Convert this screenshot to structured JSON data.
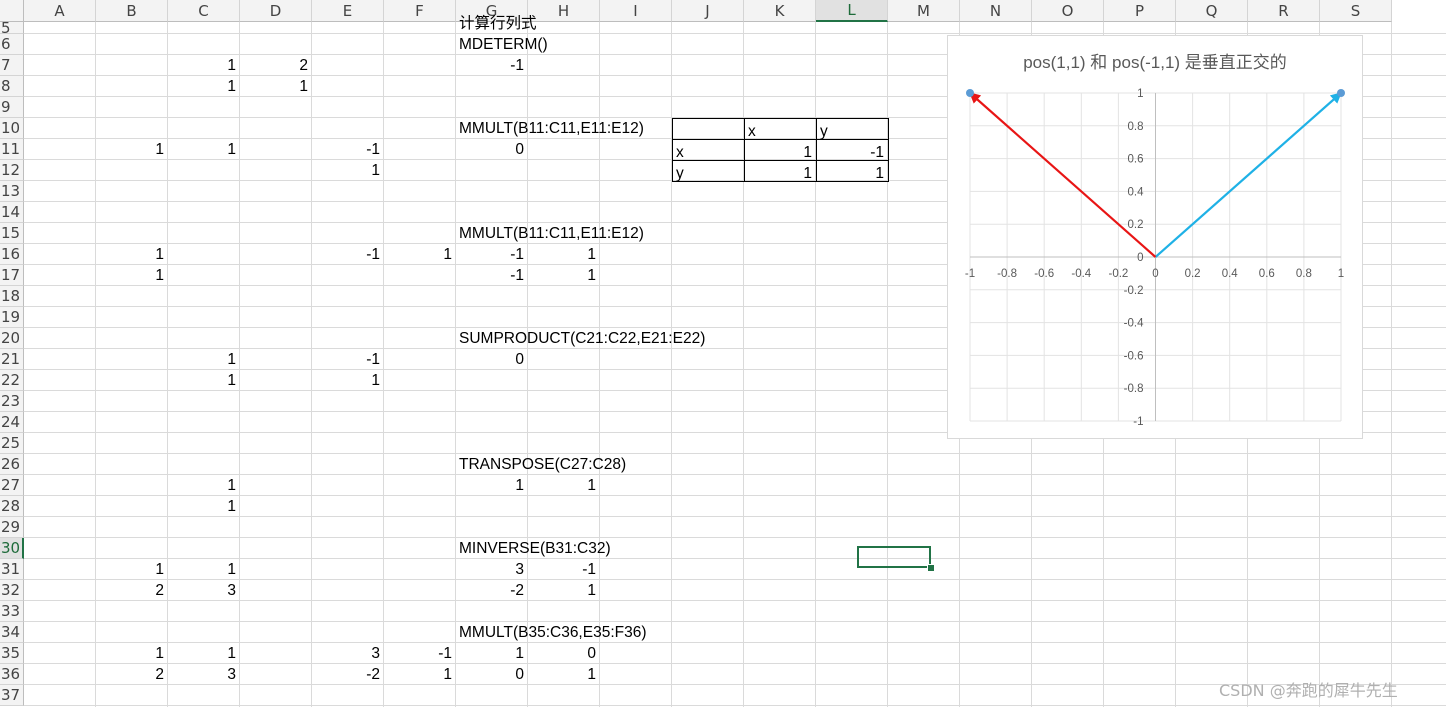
{
  "columns": [
    "A",
    "B",
    "C",
    "D",
    "E",
    "F",
    "G",
    "H",
    "I",
    "J",
    "K",
    "L",
    "M",
    "N",
    "O",
    "P",
    "Q",
    "R",
    "S"
  ],
  "selected_column": "L",
  "rows": [
    "5",
    "6",
    "7",
    "8",
    "9",
    "10",
    "11",
    "12",
    "13",
    "14",
    "15",
    "16",
    "17",
    "18",
    "19",
    "20",
    "21",
    "22",
    "23",
    "24",
    "25",
    "26",
    "27",
    "28",
    "29",
    "30",
    "31",
    "32",
    "33",
    "34",
    "35",
    "36",
    "37"
  ],
  "selected_row": "30",
  "cells": [
    {
      "ref": "G5",
      "v": "计算行列式"
    },
    {
      "ref": "G6",
      "v": "MDETERM()"
    },
    {
      "ref": "C7",
      "v": "1"
    },
    {
      "ref": "D7",
      "v": "2"
    },
    {
      "ref": "G7",
      "v": "-1"
    },
    {
      "ref": "C8",
      "v": "1"
    },
    {
      "ref": "D8",
      "v": "1"
    },
    {
      "ref": "G10",
      "v": "MMULT(B11:C11,E11:E12)"
    },
    {
      "ref": "B11",
      "v": "1"
    },
    {
      "ref": "C11",
      "v": "1"
    },
    {
      "ref": "E11",
      "v": "-1"
    },
    {
      "ref": "G11",
      "v": "0"
    },
    {
      "ref": "E12",
      "v": "1"
    },
    {
      "ref": "G15",
      "v": "MMULT(B11:C11,E11:E12)"
    },
    {
      "ref": "B16",
      "v": "1"
    },
    {
      "ref": "E16",
      "v": "-1"
    },
    {
      "ref": "F16",
      "v": "1"
    },
    {
      "ref": "G16",
      "v": "-1"
    },
    {
      "ref": "H16",
      "v": "1"
    },
    {
      "ref": "B17",
      "v": "1"
    },
    {
      "ref": "G17",
      "v": "-1"
    },
    {
      "ref": "H17",
      "v": "1"
    },
    {
      "ref": "G20",
      "v": "SUMPRODUCT(C21:C22,E21:E22)"
    },
    {
      "ref": "C21",
      "v": "1"
    },
    {
      "ref": "E21",
      "v": "-1"
    },
    {
      "ref": "G21",
      "v": "0"
    },
    {
      "ref": "C22",
      "v": "1"
    },
    {
      "ref": "E22",
      "v": "1"
    },
    {
      "ref": "G26",
      "v": "TRANSPOSE(C27:C28)"
    },
    {
      "ref": "C27",
      "v": "1"
    },
    {
      "ref": "G27",
      "v": "1"
    },
    {
      "ref": "H27",
      "v": "1"
    },
    {
      "ref": "C28",
      "v": "1"
    },
    {
      "ref": "G30",
      "v": "MINVERSE(B31:C32)"
    },
    {
      "ref": "B31",
      "v": "1"
    },
    {
      "ref": "C31",
      "v": "1"
    },
    {
      "ref": "G31",
      "v": "3"
    },
    {
      "ref": "H31",
      "v": "-1"
    },
    {
      "ref": "B32",
      "v": "2"
    },
    {
      "ref": "C32",
      "v": "3"
    },
    {
      "ref": "G32",
      "v": "-2"
    },
    {
      "ref": "H32",
      "v": "1"
    },
    {
      "ref": "G34",
      "v": "MMULT(B35:C36,E35:F36)"
    },
    {
      "ref": "B35",
      "v": "1"
    },
    {
      "ref": "C35",
      "v": "1"
    },
    {
      "ref": "E35",
      "v": "3"
    },
    {
      "ref": "F35",
      "v": "-1"
    },
    {
      "ref": "G35",
      "v": "1"
    },
    {
      "ref": "H35",
      "v": "0"
    },
    {
      "ref": "B36",
      "v": "2"
    },
    {
      "ref": "C36",
      "v": "3"
    },
    {
      "ref": "E36",
      "v": "-2"
    },
    {
      "ref": "F36",
      "v": "1"
    },
    {
      "ref": "G36",
      "v": "0"
    },
    {
      "ref": "H36",
      "v": "1"
    }
  ],
  "bordered_table": {
    "header": [
      "",
      "x",
      "y"
    ],
    "rows": [
      [
        "x",
        "1",
        "-1"
      ],
      [
        "y",
        "1",
        "1"
      ]
    ]
  },
  "chart_data": {
    "type": "scatter",
    "title": "pos(1,1) 和 pos(-1,1) 是垂直正交的",
    "xlim": [
      -1,
      1
    ],
    "ylim": [
      -1,
      1
    ],
    "x_ticks": [
      "-1",
      "-0.8",
      "-0.6",
      "-0.4",
      "-0.2",
      "0",
      "0.2",
      "0.4",
      "0.6",
      "0.8",
      "1"
    ],
    "y_ticks": [
      "1",
      "0.8",
      "0.6",
      "0.4",
      "0.2",
      "0",
      "-0.2",
      "-0.4",
      "-0.6",
      "-0.8",
      "-1"
    ],
    "grid": true,
    "series": [
      {
        "color": "#1fb1e6",
        "points": [
          [
            0,
            0
          ],
          [
            1,
            1
          ]
        ]
      },
      {
        "color": "#e81515",
        "points": [
          [
            0,
            0
          ],
          [
            -1,
            1
          ]
        ]
      }
    ],
    "marker_color": "#5b9bd5"
  },
  "watermark": "CSDN @奔跑的犀牛先生"
}
